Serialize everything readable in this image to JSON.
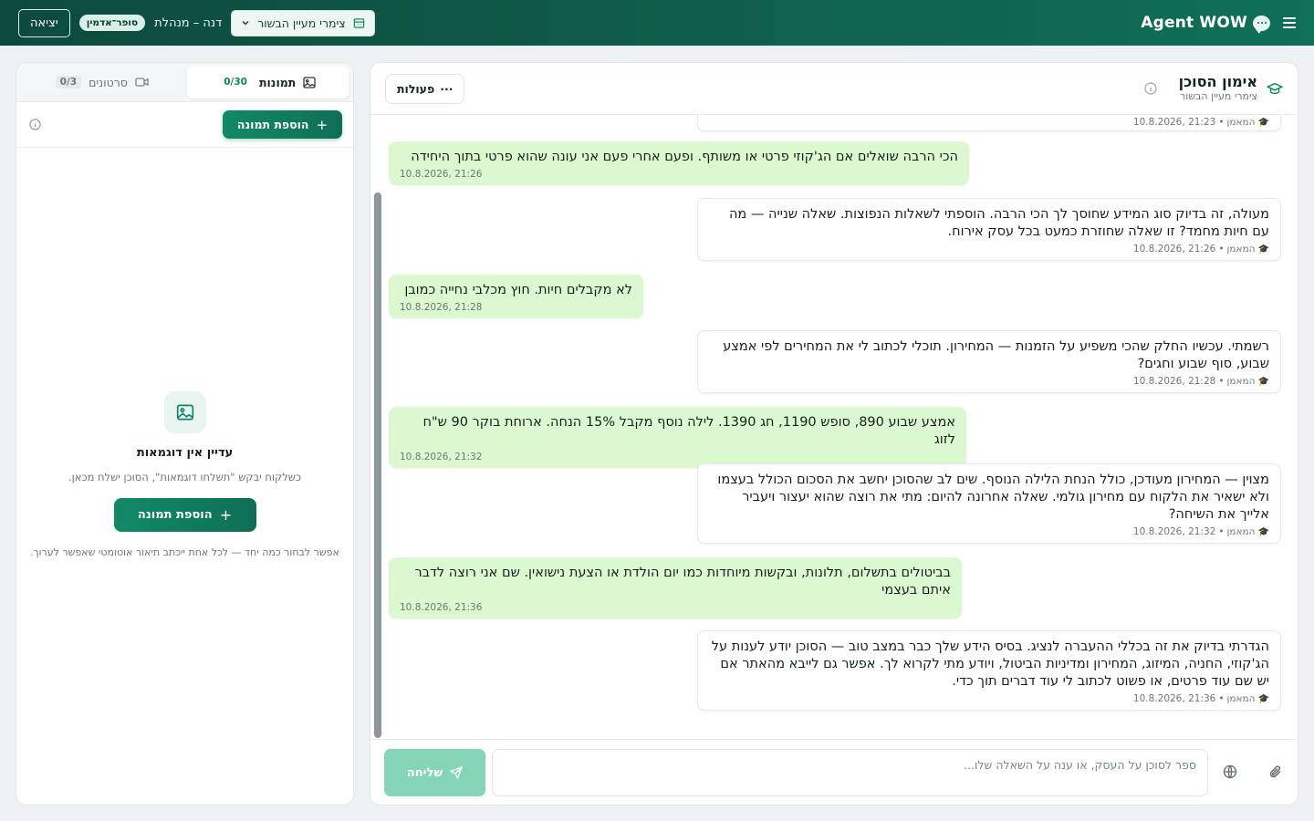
{
  "header": {
    "brand": "Agent WOW",
    "tenant_select": "צימרי מעיין הבשור",
    "user_name": "דנה – מנהלת",
    "role_badge": "סופר־אדמין",
    "logout_label": "יציאה"
  },
  "chat": {
    "title": "אימון הסוכן",
    "subtitle": "צימרי מעיין הבשור",
    "actions_label": "פעולות",
    "messages": [
      {
        "role": "agent",
        "text": "",
        "sender": "המאמן",
        "time": "21:23 ,10.8.2026"
      },
      {
        "role": "user",
        "text": "הכי הרבה שואלים אם הג'קוזי פרטי או משותף. ופעם אחרי פעם אני עונה שהוא פרטי בתוך היחידה",
        "time": "21:26 ,10.8.2026"
      },
      {
        "role": "agent",
        "text": "מעולה, זה בדיוק סוג המידע שחוסך לך הכי הרבה. הוספתי לשאלות הנפוצות. שאלה שנייה — מה עם חיות מחמד? זו שאלה שחוזרת כמעט בכל עסק אירוח.",
        "sender": "המאמן",
        "time": "21:26 ,10.8.2026"
      },
      {
        "role": "user",
        "text": "לא מקבלים חיות. חוץ מכלבי נחייה כמובן",
        "time": "21:28 ,10.8.2026"
      },
      {
        "role": "agent",
        "text": "רשמתי. עכשיו החלק שהכי משפיע על הזמנות — המחירון. תוכלי לכתוב לי את המחירים לפי אמצע שבוע, סוף שבוע וחגים?",
        "sender": "המאמן",
        "time": "21:28 ,10.8.2026"
      },
      {
        "role": "user",
        "text": "אמצע שבוע 890, סופש 1190, חג 1390. לילה נוסף מקבל 15% הנחה. ארוחת בוקר 90 ש\"ח לזוג",
        "time": "21:32 ,10.8.2026"
      },
      {
        "role": "agent",
        "text": "מצוין — המחירון מעודכן, כולל הנחת הלילה הנוסף. שים לב שהסוכן יחשב את הסכום הכולל בעצמו ולא ישאיר את הלקוח עם מחירון גולמי. שאלה אחרונה להיום: מתי את רוצה שהוא יעצור ויעביר אלייך את השיחה?",
        "sender": "המאמן",
        "time": "21:32 ,10.8.2026"
      },
      {
        "role": "user",
        "text": "בביטולים בתשלום, תלונות, ובקשות מיוחדות כמו יום הולדת או הצעת נישואין. שם אני רוצה לדבר איתם בעצמי",
        "time": "21:36 ,10.8.2026"
      },
      {
        "role": "agent",
        "text": "הגדרתי בדיוק את זה בכללי ההעברה לנציג. בסיס הידע שלך כבר במצב טוב — הסוכן יודע לענות על הג'קוזי, החניה, המיזוג, המחירון ומדיניות הביטול, ויודע מתי לקרוא לך. אפשר גם לייבא מהאתר אם יש שם עוד פרטים, או פשוט לכתוב לי עוד דברים תוך כדי.",
        "sender": "המאמן",
        "time": "21:36 ,10.8.2026"
      }
    ],
    "composer_placeholder": "ספר לסוכן על העסק, או ענה על השאלה שלו...",
    "send_label": "שליחה"
  },
  "media": {
    "tabs": [
      {
        "label": "תמונות",
        "count": "0/30",
        "active": true
      },
      {
        "label": "סרטונים",
        "count": "0/3",
        "active": false
      }
    ],
    "add_image_label": "הוספת תמונה",
    "empty_title": "עדיין אין דוגמאות",
    "empty_desc": "כשלקוח יבקש \"תשלחו דוגמאות\", הסוכן ישלח מכאן.",
    "empty_button": "הוספת תמונה",
    "empty_hint": "אפשר לבחור כמה יחד — לכל אחת ייכתב תיאור אוטומטי שאפשר לערוך."
  },
  "colors": {
    "brand_dark": "#0c4a3d",
    "brand_accent": "#118a68",
    "user_bubble": "#dcf8d0",
    "send_button_disabled": "#85d5b8"
  },
  "icons": [
    "menu-icon",
    "chat-bubble-icon",
    "building-icon",
    "chevron-down-icon",
    "graduation-cap-icon",
    "info-icon",
    "ellipsis-icon",
    "paperclip-icon",
    "globe-icon",
    "send-icon",
    "image-icon",
    "video-icon",
    "plus-icon"
  ]
}
